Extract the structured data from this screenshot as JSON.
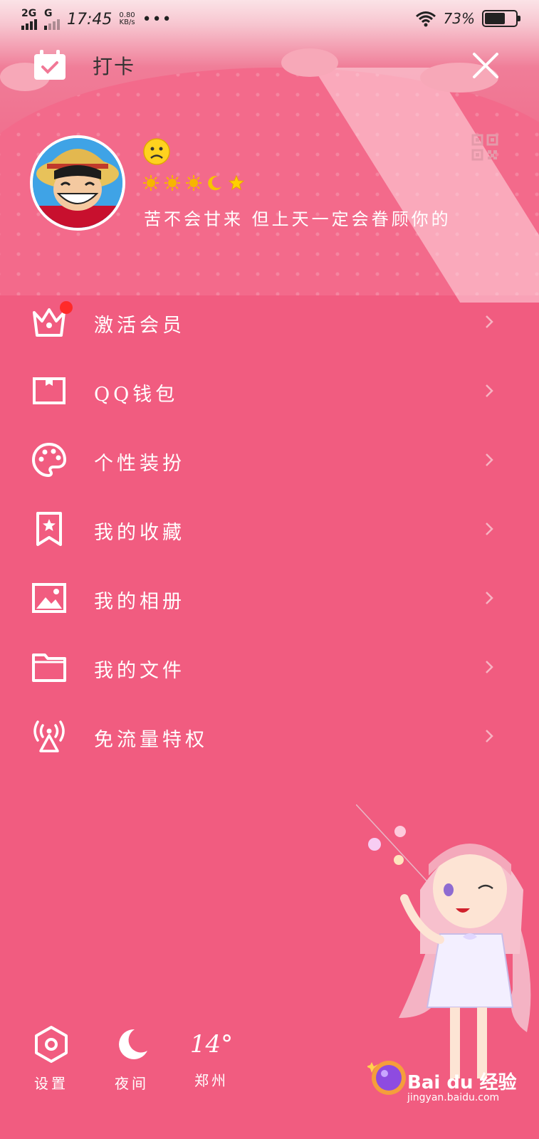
{
  "status_bar": {
    "network_1": "2G",
    "network_2": "G",
    "time": "17:45",
    "speed_value": "0.80",
    "speed_unit": "KB/s",
    "more": "•••",
    "battery_percent": "73%",
    "battery_level": 0.73
  },
  "header": {
    "checkin_label": "打卡"
  },
  "profile": {
    "signature": "苦不会甘来 但上天一定会眷顾你的",
    "level_icons": [
      "sun-icon",
      "sun-icon",
      "sun-icon",
      "moon-icon",
      "star-icon"
    ]
  },
  "menu": {
    "items": [
      {
        "label": "激活会员",
        "icon": "crown-icon"
      },
      {
        "label": "QQ钱包",
        "icon": "wallet-icon"
      },
      {
        "label": "个性装扮",
        "icon": "palette-icon"
      },
      {
        "label": "我的收藏",
        "icon": "bookmark-star-icon"
      },
      {
        "label": "我的相册",
        "icon": "image-icon"
      },
      {
        "label": "我的文件",
        "icon": "folder-icon"
      },
      {
        "label": "免流量特权",
        "icon": "antenna-icon"
      }
    ]
  },
  "bottom": {
    "settings_label": "设置",
    "night_label": "夜间",
    "weather_temp": "14°",
    "weather_city": "郑州"
  },
  "watermark": {
    "text": "Bai du 经验",
    "url": "jingyan.baidu.com"
  },
  "colors": {
    "background": "#f15c80",
    "badge": "#ff2a2a",
    "sun": "#f7b500"
  }
}
